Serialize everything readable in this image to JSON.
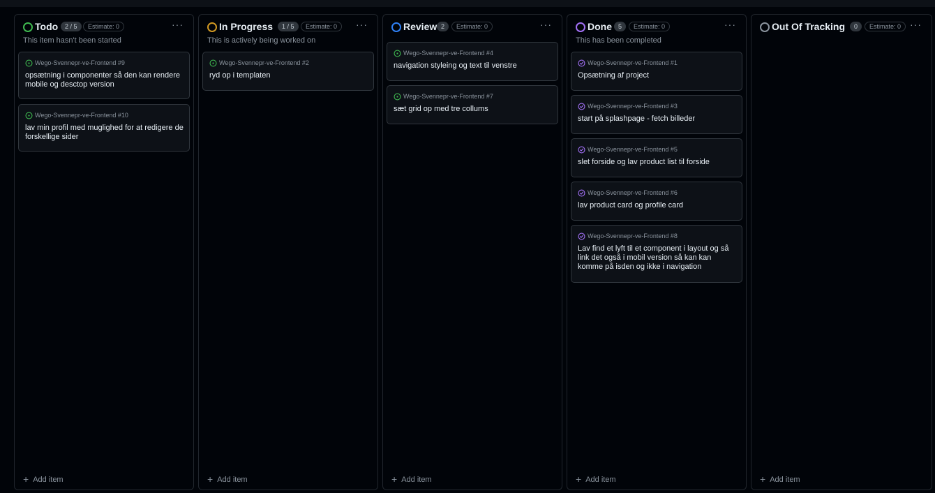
{
  "columns": [
    {
      "title": "Todo",
      "count": "2 / 5",
      "estimate": "Estimate: 0",
      "description": "This item hasn't been started",
      "status_color": "#3fb950",
      "add_label": "Add item",
      "cards": [
        {
          "ref": "Wego-Svennepr-ve-Frontend #9",
          "title": "opsætning i componenter så den kan rendere mobile og desctop version",
          "state": "open"
        },
        {
          "ref": "Wego-Svennepr-ve-Frontend #10",
          "title": "lav min profil med muglighed for at redigere de forskellige sider",
          "state": "open"
        }
      ]
    },
    {
      "title": "In Progress",
      "count": "1 / 5",
      "estimate": "Estimate: 0",
      "description": "This is actively being worked on",
      "status_color": "#d29922",
      "add_label": "Add item",
      "cards": [
        {
          "ref": "Wego-Svennepr-ve-Frontend #2",
          "title": "ryd op i templaten",
          "state": "open"
        }
      ]
    },
    {
      "title": "Review",
      "count": "2",
      "estimate": "Estimate: 0",
      "description": "",
      "status_color": "#2f81f7",
      "add_label": "Add item",
      "cards": [
        {
          "ref": "Wego-Svennepr-ve-Frontend #4",
          "title": "navigation styleing og text til venstre",
          "state": "open"
        },
        {
          "ref": "Wego-Svennepr-ve-Frontend #7",
          "title": "sæt grid op med tre collums",
          "state": "open"
        }
      ]
    },
    {
      "title": "Done",
      "count": "5",
      "estimate": "Estimate: 0",
      "description": "This has been completed",
      "status_color": "#a371f7",
      "add_label": "Add item",
      "cards": [
        {
          "ref": "Wego-Svennepr-ve-Frontend #1",
          "title": "Opsætning af project",
          "state": "closed"
        },
        {
          "ref": "Wego-Svennepr-ve-Frontend #3",
          "title": "start på splashpage - fetch billeder",
          "state": "closed"
        },
        {
          "ref": "Wego-Svennepr-ve-Frontend #5",
          "title": "slet forside og lav product list til forside",
          "state": "closed"
        },
        {
          "ref": "Wego-Svennepr-ve-Frontend #6",
          "title": "lav product card og profile card",
          "state": "closed"
        },
        {
          "ref": "Wego-Svennepr-ve-Frontend #8",
          "title": "Lav find et lyft til et component i layout og så link det også i mobil version så kan kan komme på isden og ikke i navigation",
          "state": "closed"
        }
      ]
    },
    {
      "title": "Out Of Tracking",
      "count": "0",
      "estimate": "Estimate: 0",
      "description": "",
      "status_color": "#8b949e",
      "add_label": "Add item",
      "cards": []
    }
  ],
  "more_glyph": "···",
  "add_glyph": "+"
}
